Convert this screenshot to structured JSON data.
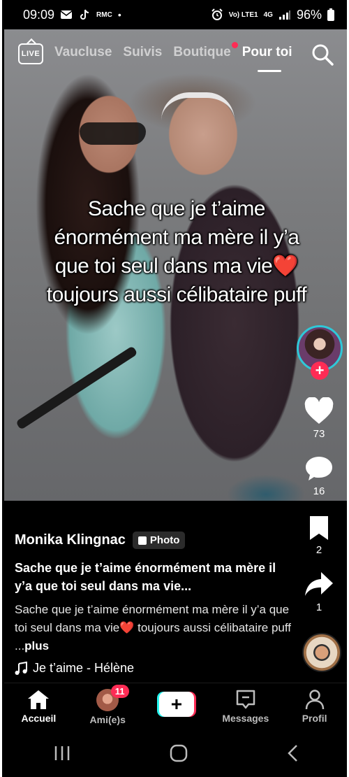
{
  "status_bar": {
    "time": "09:09",
    "left_icons": [
      "mail-icon",
      "tiktok-icon",
      "rmc-icon"
    ],
    "rmc_label": "RMC",
    "dot": "•",
    "volte_label": "Vo) LTE1",
    "network_label": "4G",
    "battery": "96%"
  },
  "top_nav": {
    "live_label": "LIVE",
    "tabs": [
      {
        "label": "Vaucluse",
        "active": false
      },
      {
        "label": "Suivis",
        "active": false
      },
      {
        "label": "Boutique",
        "active": false,
        "notification_dot": true
      },
      {
        "label": "Pour toi",
        "active": true
      }
    ]
  },
  "post": {
    "overlay_text": "Sache que je t’aime énormément ma mère il y’a que toi seul dans ma vie❤️ toujours aussi célibataire puff",
    "author": "Monika Klingnac",
    "type_badge": "Photo",
    "headline": "Sache que je t’aime énormément ma mère il y’a que toi seul dans ma vie...",
    "description": "Sache que je t’aime énormément ma mère il y’a que toi seul dans ma vie❤️ toujours aussi célibataire puff ...",
    "more_label": "plus",
    "music": "Je t’aime - Hélène"
  },
  "actions": {
    "likes": "73",
    "comments": "16",
    "saves": "2",
    "shares": "1"
  },
  "bottom_nav": {
    "items": [
      {
        "label": "Accueil",
        "icon": "home-icon",
        "active": true
      },
      {
        "label": "Ami(e)s",
        "icon": "friends-avatar",
        "badge": "11"
      },
      {
        "label": "",
        "icon": "create-plus-icon"
      },
      {
        "label": "Messages",
        "icon": "messages-icon"
      },
      {
        "label": "Profil",
        "icon": "profile-icon"
      }
    ]
  },
  "colors": {
    "accent_red": "#fe2c55",
    "accent_cyan": "#25f4ee"
  }
}
